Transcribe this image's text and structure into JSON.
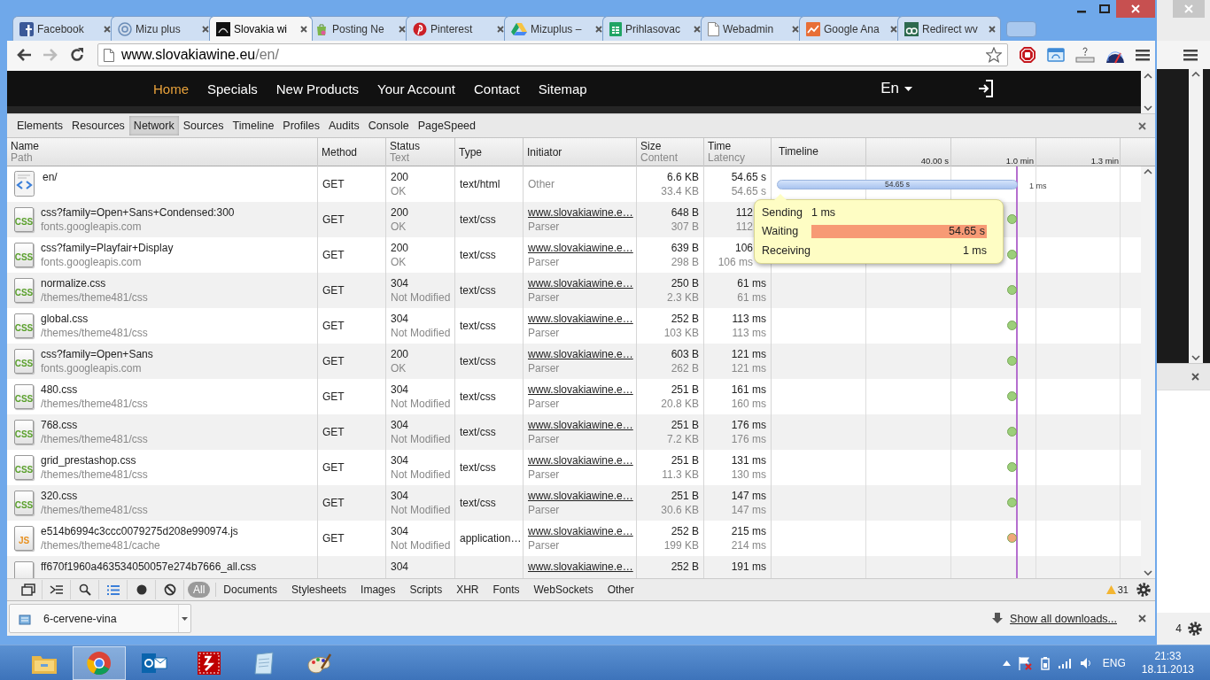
{
  "browser_tabs": [
    {
      "title": "Facebook",
      "kind": "facebook",
      "selected": false
    },
    {
      "title": "Mizu plus",
      "kind": "ring",
      "selected": false
    },
    {
      "title": "Slovakia wi",
      "kind": "dark",
      "selected": true
    },
    {
      "title": "Posting Ne",
      "kind": "bag",
      "selected": false
    },
    {
      "title": "Pinterest",
      "kind": "pin",
      "selected": false
    },
    {
      "title": "Mizuplus –",
      "kind": "triangle",
      "selected": false
    },
    {
      "title": "Prihlasovac",
      "kind": "sheet",
      "selected": false
    },
    {
      "title": "Webadmin",
      "kind": "page",
      "selected": false
    },
    {
      "title": "Google Ana",
      "kind": "chart",
      "selected": false
    },
    {
      "title": "Redirect wv",
      "kind": "green",
      "selected": false
    }
  ],
  "toolbar": {
    "address": {
      "host": "www.slovakiawine.eu",
      "path": "/en/"
    }
  },
  "site_nav": {
    "items": [
      {
        "label": "Home",
        "selected": true
      },
      {
        "label": "Specials",
        "selected": false
      },
      {
        "label": "New Products",
        "selected": false
      },
      {
        "label": "Your Account",
        "selected": false
      },
      {
        "label": "Contact",
        "selected": false
      },
      {
        "label": "Sitemap",
        "selected": false
      }
    ],
    "language": "En"
  },
  "devtools": {
    "tabs": [
      {
        "label": "Elements",
        "selected": false
      },
      {
        "label": "Resources",
        "selected": false
      },
      {
        "label": "Network",
        "selected": true
      },
      {
        "label": "Sources",
        "selected": false
      },
      {
        "label": "Timeline",
        "selected": false
      },
      {
        "label": "Profiles",
        "selected": false
      },
      {
        "label": "Audits",
        "selected": false
      },
      {
        "label": "Console",
        "selected": false
      },
      {
        "label": "PageSpeed",
        "selected": false
      }
    ],
    "network": {
      "columns": [
        {
          "label": "Name",
          "sub": "Path"
        },
        {
          "label": "Method"
        },
        {
          "label": "Status",
          "sub": "Text"
        },
        {
          "label": "Type"
        },
        {
          "label": "Initiator"
        },
        {
          "label": "Size",
          "sub": "Content"
        },
        {
          "label": "Time",
          "sub": "Latency"
        }
      ],
      "timeline_header": {
        "label": "Timeline",
        "ticks": [
          "40.00 s",
          "1.0 min",
          "1.3 min"
        ]
      },
      "rows": [
        {
          "kind": "html",
          "name": "en/",
          "method": "GET",
          "status": "200",
          "status_text": "OK",
          "type": "text/html",
          "initiator": {
            "kind": "plain",
            "text": "Other"
          },
          "size": "6.6 KB",
          "content": "33.4 KB",
          "time": "54.65 s",
          "latency": "54.65 s",
          "timeline": {
            "kind": "bar",
            "label": "54.65 s",
            "duration": "1 ms"
          }
        },
        {
          "kind": "css",
          "icon_label": "CSS",
          "name": "css?family=Open+Sans+Condensed:300",
          "path": "fonts.googleapis.com",
          "method": "GET",
          "status": "200",
          "status_text": "OK",
          "type": "text/css",
          "initiator": {
            "kind": "link",
            "text": "www.slovakiawine.e…",
            "detail": "Parser"
          },
          "size": "648 B",
          "content": "307 B",
          "time": "112",
          "latency": "112",
          "time_covered": true,
          "timeline": {
            "kind": "dot",
            "color": "#9ccf7a"
          }
        },
        {
          "kind": "css",
          "icon_label": "CSS",
          "name": "css?family=Playfair+Display",
          "path": "fonts.googleapis.com",
          "method": "GET",
          "status": "200",
          "status_text": "OK",
          "type": "text/css",
          "initiator": {
            "kind": "link",
            "text": "www.slovakiawine.e…",
            "detail": "Parser"
          },
          "size": "639 B",
          "content": "298 B",
          "time": "106",
          "latency": "106 ms",
          "time_covered": true,
          "timeline": {
            "kind": "dot",
            "color": "#9ccf7a"
          }
        },
        {
          "kind": "css",
          "icon_label": "CSS",
          "name": "normalize.css",
          "path": "/themes/theme481/css",
          "method": "GET",
          "status": "304",
          "status_text": "Not Modified",
          "type": "text/css",
          "initiator": {
            "kind": "link",
            "text": "www.slovakiawine.e…",
            "detail": "Parser"
          },
          "size": "250 B",
          "content": "2.3 KB",
          "time": "61 ms",
          "latency": "61 ms",
          "timeline": {
            "kind": "dot",
            "color": "#9ccf7a"
          }
        },
        {
          "kind": "css",
          "icon_label": "CSS",
          "name": "global.css",
          "path": "/themes/theme481/css",
          "method": "GET",
          "status": "304",
          "status_text": "Not Modified",
          "type": "text/css",
          "initiator": {
            "kind": "link",
            "text": "www.slovakiawine.e…",
            "detail": "Parser"
          },
          "size": "252 B",
          "content": "103 KB",
          "time": "113 ms",
          "latency": "113 ms",
          "timeline": {
            "kind": "dot",
            "color": "#9ccf7a"
          }
        },
        {
          "kind": "css",
          "icon_label": "CSS",
          "name": "css?family=Open+Sans",
          "path": "fonts.googleapis.com",
          "method": "GET",
          "status": "200",
          "status_text": "OK",
          "type": "text/css",
          "initiator": {
            "kind": "link",
            "text": "www.slovakiawine.e…",
            "detail": "Parser"
          },
          "size": "603 B",
          "content": "262 B",
          "time": "121 ms",
          "latency": "121 ms",
          "timeline": {
            "kind": "dot",
            "color": "#9ccf7a"
          }
        },
        {
          "kind": "css",
          "icon_label": "CSS",
          "name": "480.css",
          "path": "/themes/theme481/css",
          "method": "GET",
          "status": "304",
          "status_text": "Not Modified",
          "type": "text/css",
          "initiator": {
            "kind": "link",
            "text": "www.slovakiawine.e…",
            "detail": "Parser"
          },
          "size": "251 B",
          "content": "20.8 KB",
          "time": "161 ms",
          "latency": "160 ms",
          "timeline": {
            "kind": "dot",
            "color": "#9ccf7a"
          }
        },
        {
          "kind": "css",
          "icon_label": "CSS",
          "name": "768.css",
          "path": "/themes/theme481/css",
          "method": "GET",
          "status": "304",
          "status_text": "Not Modified",
          "type": "text/css",
          "initiator": {
            "kind": "link",
            "text": "www.slovakiawine.e…",
            "detail": "Parser"
          },
          "size": "251 B",
          "content": "7.2 KB",
          "time": "176 ms",
          "latency": "176 ms",
          "timeline": {
            "kind": "dot",
            "color": "#9ccf7a"
          }
        },
        {
          "kind": "css",
          "icon_label": "CSS",
          "name": "grid_prestashop.css",
          "path": "/themes/theme481/css",
          "method": "GET",
          "status": "304",
          "status_text": "Not Modified",
          "type": "text/css",
          "initiator": {
            "kind": "link",
            "text": "www.slovakiawine.e…",
            "detail": "Parser"
          },
          "size": "251 B",
          "content": "11.3 KB",
          "time": "131 ms",
          "latency": "130 ms",
          "timeline": {
            "kind": "dot",
            "color": "#9ccf7a"
          }
        },
        {
          "kind": "css",
          "icon_label": "CSS",
          "name": "320.css",
          "path": "/themes/theme481/css",
          "method": "GET",
          "status": "304",
          "status_text": "Not Modified",
          "type": "text/css",
          "initiator": {
            "kind": "link",
            "text": "www.slovakiawine.e…",
            "detail": "Parser"
          },
          "size": "251 B",
          "content": "30.6 KB",
          "time": "147 ms",
          "latency": "147 ms",
          "timeline": {
            "kind": "dot",
            "color": "#9ccf7a"
          }
        },
        {
          "kind": "js",
          "icon_label": "JS",
          "name": "e514b6994c3ccc0079275d208e990974.js",
          "path": "/themes/theme481/cache",
          "method": "GET",
          "status": "304",
          "status_text": "Not Modified",
          "type": "application…",
          "initiator": {
            "kind": "link",
            "text": "www.slovakiawine.e…",
            "detail": "Parser"
          },
          "size": "252 B",
          "content": "199 KB",
          "time": "215 ms",
          "latency": "214 ms",
          "timeline": {
            "kind": "dot",
            "color": "#f0a878"
          }
        },
        {
          "kind": "css",
          "name": "ff670f1960a463534050057e274b7666_all.css",
          "status": "304",
          "initiator": {
            "kind": "link",
            "text": "www.slovakiawine.e…"
          },
          "size": "252 B",
          "time": "191 ms"
        }
      ],
      "tooltip": {
        "phases": [
          {
            "label": "Sending",
            "value": "1 ms",
            "kind": "start"
          },
          {
            "label": "Waiting",
            "value": "54.65 s",
            "kind": "bar",
            "level": 1
          },
          {
            "label": "Receiving",
            "value": "1 ms",
            "kind": "end"
          }
        ]
      }
    },
    "tools": [
      {
        "kind": "dock",
        "selected": false
      },
      {
        "kind": "console",
        "selected": false
      },
      {
        "kind": "search",
        "selected": false
      },
      {
        "kind": "list",
        "selected": true
      },
      {
        "kind": "record",
        "selected": false
      },
      {
        "kind": "clear",
        "selected": false
      }
    ],
    "filters": [
      {
        "label": "All",
        "selected": true
      },
      {
        "label": "Documents",
        "selected": false
      },
      {
        "label": "Stylesheets",
        "selected": false
      },
      {
        "label": "Images",
        "selected": false
      },
      {
        "label": "Scripts",
        "selected": false
      },
      {
        "label": "XHR",
        "selected": false
      },
      {
        "label": "Fonts",
        "selected": false
      },
      {
        "label": "WebSockets",
        "selected": false
      },
      {
        "label": "Other",
        "selected": false
      }
    ],
    "warnings": "31"
  },
  "downloads": {
    "file": "6-cervene-vina",
    "show_all": "Show all downloads..."
  },
  "background_window": {
    "count": "4"
  },
  "taskbar": {
    "apps": [
      {
        "kind": "explorer",
        "selected": false
      },
      {
        "kind": "chrome",
        "selected": true
      },
      {
        "kind": "mail",
        "selected": false
      },
      {
        "kind": "ftp",
        "selected": false
      },
      {
        "kind": "notes",
        "selected": false
      },
      {
        "kind": "paint",
        "selected": false
      }
    ],
    "language": "ENG",
    "time": "21:33",
    "date": "18.11.2013"
  }
}
